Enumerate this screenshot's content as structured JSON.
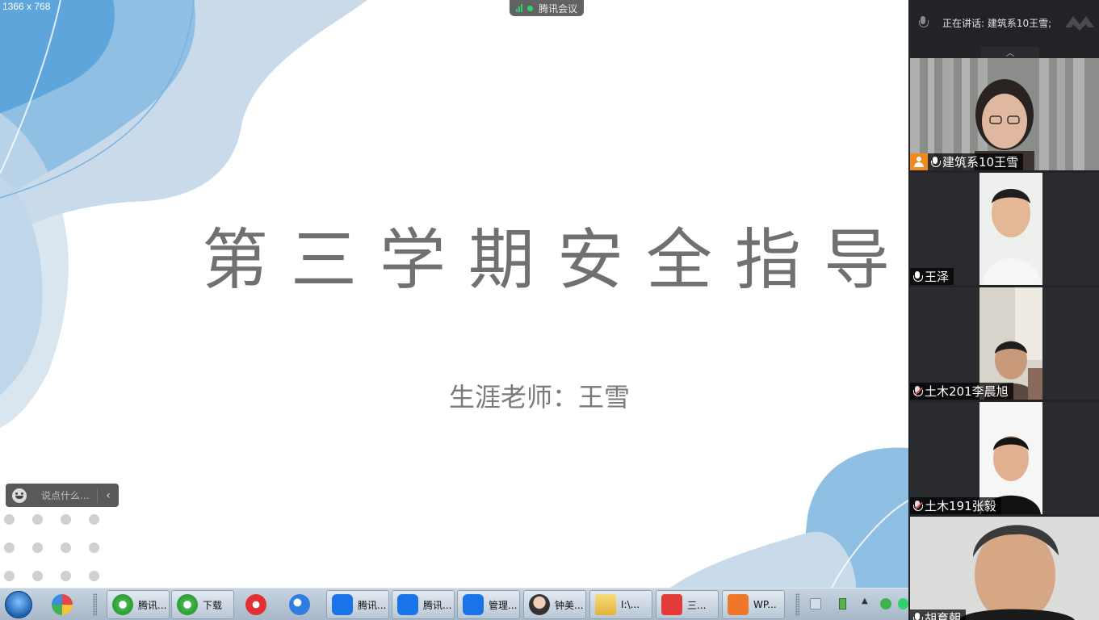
{
  "screen": {
    "resolution_label": "1366 x 768",
    "meeting_badge": "腾讯会议"
  },
  "slide": {
    "title": "第三学期安全指导",
    "subtitle": "生涯老师：王雪"
  },
  "chat": {
    "placeholder": "说点什么..."
  },
  "panel": {
    "speaking_now": "正在讲话: 建筑系10王雪;",
    "participants": [
      {
        "name": "建筑系10王雪",
        "host": true,
        "muted": false,
        "active": true
      },
      {
        "name": "王泽",
        "host": false,
        "muted": false,
        "active": false
      },
      {
        "name": "土木201李晨旭",
        "host": false,
        "muted": true,
        "active": false
      },
      {
        "name": "土木191张毅",
        "host": false,
        "muted": true,
        "active": false
      },
      {
        "name": "胡育朝",
        "host": false,
        "muted": false,
        "active": false
      }
    ]
  },
  "taskbar": {
    "items": [
      {
        "label": "腾讯...",
        "icon": "browser-icon"
      },
      {
        "label": "下载",
        "icon": "browser-icon"
      },
      {
        "label": "腾讯...",
        "icon": "tencent-meeting-icon"
      },
      {
        "label": "腾讯...",
        "icon": "tencent-meeting-icon"
      },
      {
        "label": "管理...",
        "icon": "tencent-meeting-icon"
      },
      {
        "label": "钟美...",
        "icon": "avatar-icon"
      },
      {
        "label": "I:\\...",
        "icon": "folder-icon"
      },
      {
        "label": "三...",
        "icon": "wps-writer-icon"
      },
      {
        "label": "WP...",
        "icon": "wps-presentation-icon"
      }
    ]
  },
  "colors": {
    "accent_green": "#2fd36b",
    "blob_light": "#c9dbea",
    "blob_mid": "#8fbfe3",
    "blob_dark": "#5ea5dc",
    "host_orange": "#f08a1c"
  }
}
